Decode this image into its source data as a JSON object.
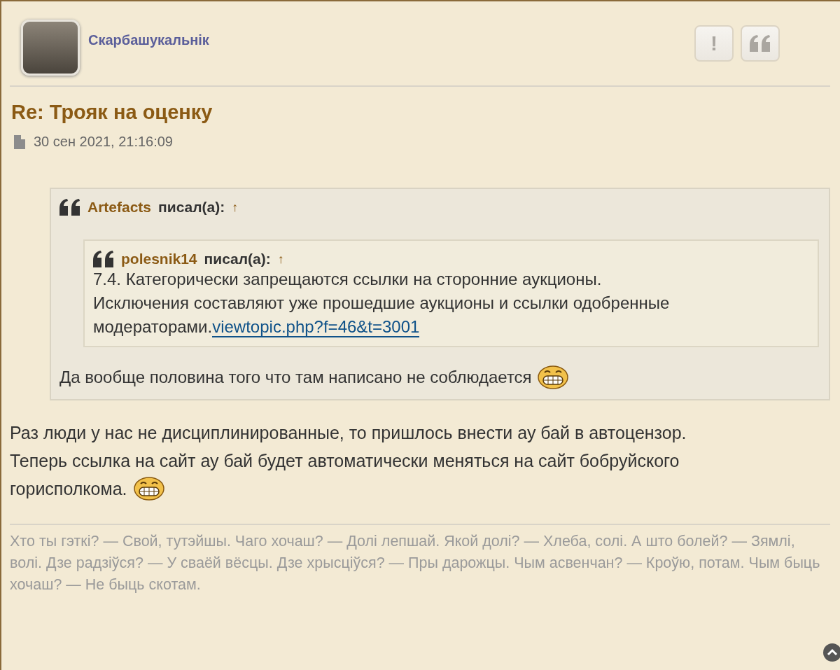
{
  "post": {
    "author": "Скарбашукальнік",
    "actions": [
      {
        "kind": "report",
        "label": "!"
      },
      {
        "kind": "quote"
      }
    ],
    "title": "Re: Трояк на оценку",
    "date": "30 сен 2021, 21:16:09",
    "quote": {
      "author": "Artefacts",
      "wrote": "писал(а):",
      "jump": "↑",
      "nested": {
        "author": "polesnik14",
        "wrote": "писал(а):",
        "jump": "↑",
        "lines": [
          "7.4. Категорически запрещаются ссылки на сторонние аукционы.",
          "Исключения составляют уже прошедшие аукционы и ссылки одобренные модераторами."
        ],
        "link": "viewtopic.php?f=46&t=3001"
      },
      "text": "Да вообще половина того что там написано не соблюдается"
    },
    "body_lines": [
      "Раз люди у нас не дисциплинированные, то пришлось внести ау бай в автоцензор.",
      "Теперь ссылка на сайт ау бай будет автоматически меняться на сайт бобруйского",
      "горисполкома."
    ],
    "signature": "Хто ты гэткі? — Свой, тутэйшы. Чаго хочаш? — Долі лепшай. Якой долі? — Хлеба, солі. А што болей? — Зямлі, волі. Дзе радзіўся? — У сваёй вёсцы. Дзе хрысціўся? — Пры дарожцы. Чым асвенчан? — Кроўю, потам. Чым быць хочаш? — Не быць скотам."
  }
}
